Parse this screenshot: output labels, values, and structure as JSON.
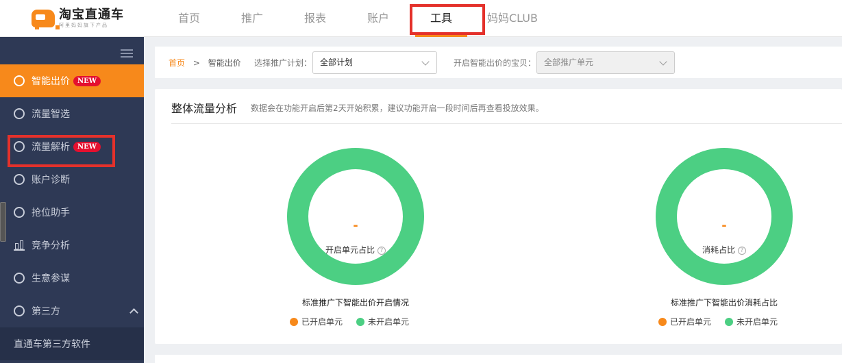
{
  "app": {
    "logo_title": "淘宝直通车",
    "logo_sub": "阿里妈妈旗下产品"
  },
  "nav": {
    "items": [
      {
        "label": "首页"
      },
      {
        "label": "推广"
      },
      {
        "label": "报表"
      },
      {
        "label": "账户"
      },
      {
        "label": "工具",
        "active": true
      },
      {
        "label": "妈妈CLUB"
      }
    ]
  },
  "sidebar": {
    "items": [
      {
        "label": "智能出价",
        "badge": "NEW",
        "active": true,
        "icon": "smart-bid-icon"
      },
      {
        "label": "流量智选",
        "icon": "traffic-select-icon"
      },
      {
        "label": "流量解析",
        "badge": "NEW",
        "icon": "traffic-analysis-icon"
      },
      {
        "label": "账户诊断",
        "icon": "diagnosis-icon"
      },
      {
        "label": "抢位助手",
        "icon": "position-icon"
      },
      {
        "label": "竞争分析",
        "icon": "bar-chart-icon"
      },
      {
        "label": "生意参谋",
        "icon": "compass-icon"
      },
      {
        "label": "第三方",
        "icon": "circle-icon",
        "expanded": true
      }
    ],
    "sub_items": [
      {
        "label": "直通车第三方软件"
      }
    ]
  },
  "filter": {
    "crumb_home": "首页",
    "crumb_sep": ">",
    "crumb_current": "智能出价",
    "plan_label": "选择推广计划：",
    "plan_value": "全部计划",
    "unit_label": "开启智能出价的宝贝：",
    "unit_value": "全部推广单元"
  },
  "panel": {
    "title": "整体流量分析",
    "desc": "数据会在功能开启后第2天开始积累，建议功能开启一段时间后再查看投放效果。"
  },
  "charts": [
    {
      "value": "-",
      "center_label": "开启单元占比",
      "caption": "标准推广下智能出价开启情况",
      "legend": [
        {
          "label": "已开启单元",
          "color": "#f7891b"
        },
        {
          "label": "未开启单元",
          "color": "#4ccf83"
        }
      ]
    },
    {
      "value": "-",
      "center_label": "消耗占比",
      "caption": "标准推广下智能出价消耗占比",
      "legend": [
        {
          "label": "已开启单元",
          "color": "#f7891b"
        },
        {
          "label": "未开启单元",
          "color": "#4ccf83"
        }
      ]
    }
  ],
  "colors": {
    "accent": "#f7891b",
    "sidebar_bg": "#2e3955",
    "donut_green": "#4ccf83",
    "highlight_red": "#e4312b",
    "badge_red": "#e4102f"
  }
}
